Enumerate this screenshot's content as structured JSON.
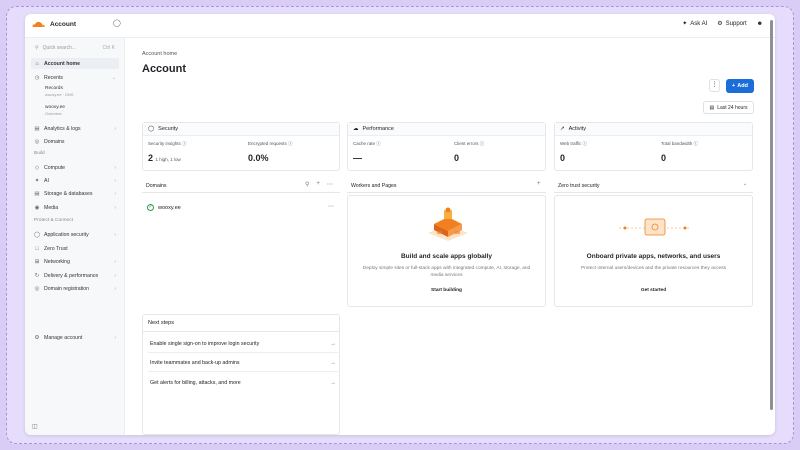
{
  "topbar": {
    "account_name": "Account",
    "ask_ai": "Ask AI",
    "support": "Support"
  },
  "sidebar": {
    "search_placeholder": "Quick search...",
    "search_shortcut": "Ctrl K",
    "items": [
      {
        "label": "Account home",
        "icon": "home-icon"
      },
      {
        "label": "Recents",
        "icon": "clock-icon"
      },
      {
        "label": "Analytics & logs",
        "icon": "chart-icon"
      },
      {
        "label": "Domains",
        "icon": "globe-icon"
      },
      {
        "label": "Compute",
        "icon": "compute-icon"
      },
      {
        "label": "AI",
        "icon": "ai-icon"
      },
      {
        "label": "Storage & databases",
        "icon": "database-icon"
      },
      {
        "label": "Media",
        "icon": "media-icon"
      },
      {
        "label": "Application security",
        "icon": "shield-icon"
      },
      {
        "label": "Zero Trust",
        "icon": "lock-icon"
      },
      {
        "label": "Networking",
        "icon": "network-icon"
      },
      {
        "label": "Delivery & performance",
        "icon": "delivery-icon"
      },
      {
        "label": "Domain registration",
        "icon": "registration-icon"
      },
      {
        "label": "Manage account",
        "icon": "gear-icon"
      }
    ],
    "recents": [
      {
        "title": "Records",
        "subtitle": "wooxy.ee · DNS"
      },
      {
        "title": "wooxy.ee",
        "subtitle": "Overview"
      }
    ],
    "section_build": "Build",
    "section_protect": "Protect & Connect"
  },
  "main": {
    "breadcrumb": "Account home",
    "title": "Account",
    "add_label": "Add",
    "time_range": "Last 24 hours",
    "stats": [
      {
        "title": "Security",
        "metrics": [
          {
            "label": "Security insights",
            "value": "2",
            "sub": "1 high, 1 low"
          },
          {
            "label": "Encrypted requests",
            "value": "0.0%",
            "sub": ""
          }
        ]
      },
      {
        "title": "Performance",
        "metrics": [
          {
            "label": "Cache rate",
            "value": "—",
            "sub": ""
          },
          {
            "label": "Client errors",
            "value": "0",
            "sub": ""
          }
        ]
      },
      {
        "title": "Activity",
        "metrics": [
          {
            "label": "Web traffic",
            "value": "0",
            "sub": ""
          },
          {
            "label": "Total bandwidth",
            "value": "0",
            "sub": ""
          }
        ]
      }
    ],
    "domains": {
      "header": "Domains",
      "list": [
        "wooxy.ee"
      ]
    },
    "workers": {
      "header": "Workers and Pages",
      "title": "Build and scale apps globally",
      "desc": "Deploy simple sites or full-stack apps with integrated compute, AI, storage, and media services",
      "button": "Start building"
    },
    "zerotrust": {
      "header": "Zero trust security",
      "title": "Onboard private apps, networks, and users",
      "desc": "Protect internal users/devices and the private resources they access",
      "button": "Get started"
    },
    "next_steps": {
      "header": "Next steps",
      "items": [
        "Enable single sign-on to improve login security",
        "Invite teammates and back-up admins",
        "Get alerts for billing, attacks, and more"
      ]
    }
  },
  "colors": {
    "accent": "#1b6dd9",
    "brand_orange": "#f38020",
    "success": "#2e9b4a"
  }
}
